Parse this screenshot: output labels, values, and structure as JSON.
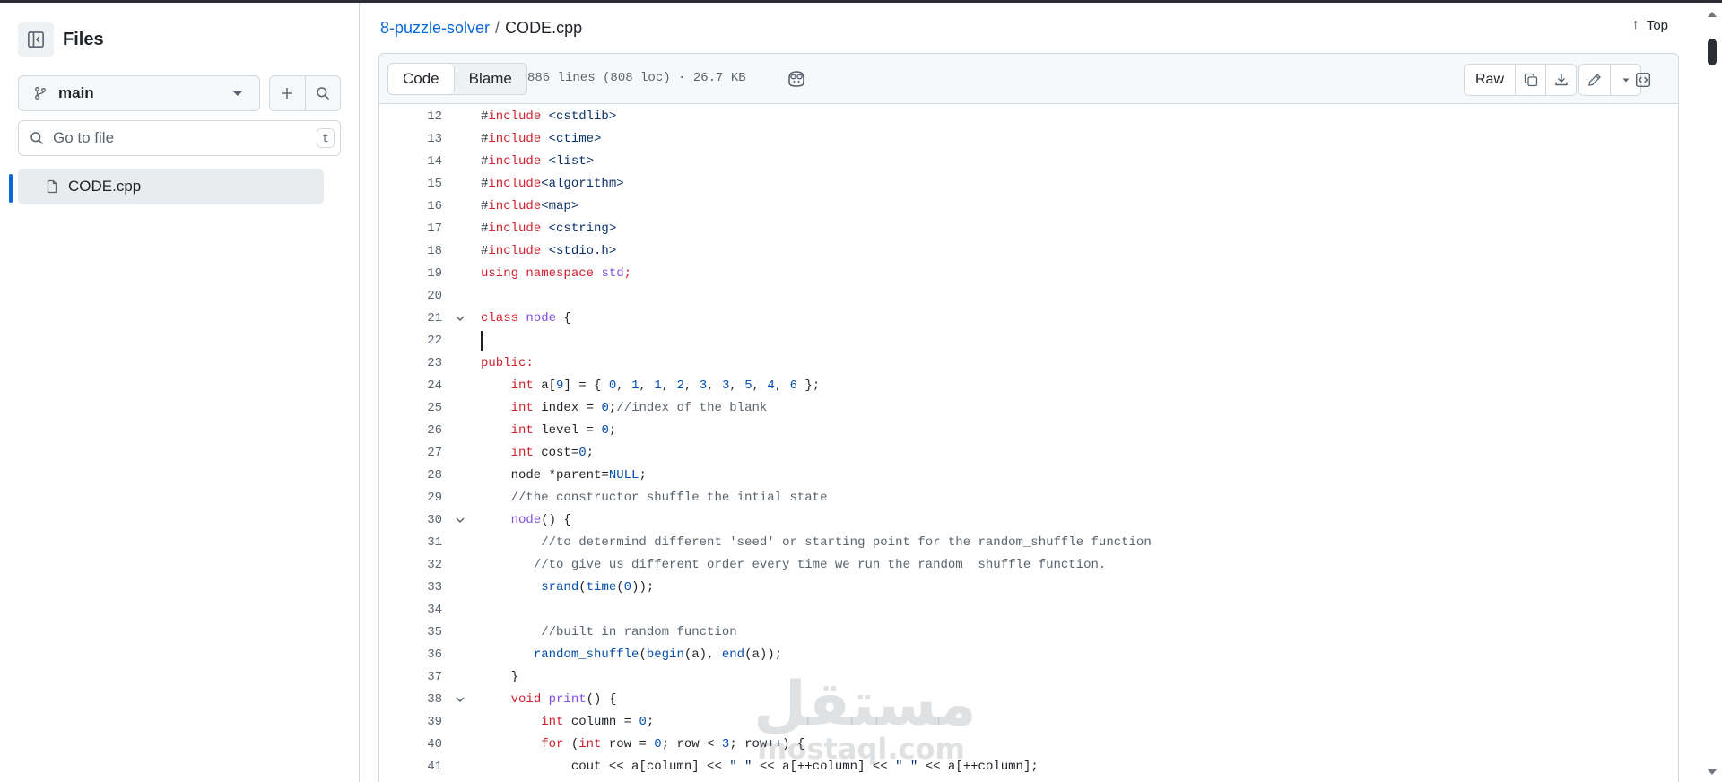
{
  "sidebar": {
    "title": "Files",
    "branch": "main",
    "goto_placeholder": "Go to file",
    "goto_shortcut": "t",
    "files": [
      "CODE.cpp"
    ]
  },
  "breadcrumb": {
    "repo": "8-puzzle-solver",
    "separator": "/",
    "file": "CODE.cpp"
  },
  "top_button": "Top",
  "file_header": {
    "tabs": [
      "Code",
      "Blame"
    ],
    "active_tab": "Code",
    "meta": "886 lines (808 loc) · 26.7 KB",
    "raw_label": "Raw"
  },
  "code_lines": [
    {
      "n": "12",
      "fold": false,
      "tokens": [
        {
          "t": "#"
        },
        {
          "t": "include",
          "c": "k"
        },
        {
          "t": " <cstdlib>",
          "c": "s2"
        }
      ]
    },
    {
      "n": "13",
      "fold": false,
      "tokens": [
        {
          "t": "#"
        },
        {
          "t": "include",
          "c": "k"
        },
        {
          "t": " <ctime>",
          "c": "s2"
        }
      ]
    },
    {
      "n": "14",
      "fold": false,
      "tokens": [
        {
          "t": "#"
        },
        {
          "t": "include",
          "c": "k"
        },
        {
          "t": " <list>",
          "c": "s2"
        }
      ]
    },
    {
      "n": "15",
      "fold": false,
      "tokens": [
        {
          "t": "#"
        },
        {
          "t": "include",
          "c": "k"
        },
        {
          "t": "<algorithm>",
          "c": "s2"
        }
      ]
    },
    {
      "n": "16",
      "fold": false,
      "tokens": [
        {
          "t": "#"
        },
        {
          "t": "include",
          "c": "k"
        },
        {
          "t": "<map>",
          "c": "s2"
        }
      ]
    },
    {
      "n": "17",
      "fold": false,
      "tokens": [
        {
          "t": "#"
        },
        {
          "t": "include",
          "c": "k"
        },
        {
          "t": " <cstring>",
          "c": "s2"
        }
      ]
    },
    {
      "n": "18",
      "fold": false,
      "tokens": [
        {
          "t": "#"
        },
        {
          "t": "include",
          "c": "k"
        },
        {
          "t": " <stdio.h>",
          "c": "s2"
        }
      ]
    },
    {
      "n": "19",
      "fold": false,
      "tokens": [
        {
          "t": "using namespace",
          "c": "k"
        },
        {
          "t": " "
        },
        {
          "t": "std",
          "c": "f"
        },
        {
          "t": ";",
          "c": "k"
        }
      ]
    },
    {
      "n": "20",
      "fold": false,
      "tokens": []
    },
    {
      "n": "21",
      "fold": true,
      "tokens": [
        {
          "t": "class",
          "c": "k"
        },
        {
          "t": " "
        },
        {
          "t": "node",
          "c": "f"
        },
        {
          "t": " {"
        }
      ]
    },
    {
      "n": "22",
      "fold": false,
      "cursor": true,
      "tokens": []
    },
    {
      "n": "23",
      "fold": false,
      "tokens": [
        {
          "t": "public:",
          "c": "k"
        }
      ]
    },
    {
      "n": "24",
      "fold": false,
      "tokens": [
        {
          "t": "    "
        },
        {
          "t": "int",
          "c": "k"
        },
        {
          "t": " a["
        },
        {
          "t": "9",
          "c": "e"
        },
        {
          "t": "] = { "
        },
        {
          "t": "0",
          "c": "e"
        },
        {
          "t": ", "
        },
        {
          "t": "1",
          "c": "e"
        },
        {
          "t": ", "
        },
        {
          "t": "1",
          "c": "e"
        },
        {
          "t": ", "
        },
        {
          "t": "2",
          "c": "e"
        },
        {
          "t": ", "
        },
        {
          "t": "3",
          "c": "e"
        },
        {
          "t": ", "
        },
        {
          "t": "3",
          "c": "e"
        },
        {
          "t": ", "
        },
        {
          "t": "5",
          "c": "e"
        },
        {
          "t": ", "
        },
        {
          "t": "4",
          "c": "e"
        },
        {
          "t": ", "
        },
        {
          "t": "6",
          "c": "e"
        },
        {
          "t": " };"
        }
      ]
    },
    {
      "n": "25",
      "fold": false,
      "tokens": [
        {
          "t": "    "
        },
        {
          "t": "int",
          "c": "k"
        },
        {
          "t": " index = "
        },
        {
          "t": "0",
          "c": "e"
        },
        {
          "t": ";"
        },
        {
          "t": "//index of the blank",
          "c": "c"
        }
      ]
    },
    {
      "n": "26",
      "fold": false,
      "tokens": [
        {
          "t": "    "
        },
        {
          "t": "int",
          "c": "k"
        },
        {
          "t": " level = "
        },
        {
          "t": "0",
          "c": "e"
        },
        {
          "t": ";"
        }
      ]
    },
    {
      "n": "27",
      "fold": false,
      "tokens": [
        {
          "t": "    "
        },
        {
          "t": "int",
          "c": "k"
        },
        {
          "t": " cost="
        },
        {
          "t": "0",
          "c": "e"
        },
        {
          "t": ";"
        }
      ]
    },
    {
      "n": "28",
      "fold": false,
      "tokens": [
        {
          "t": "    node *parent="
        },
        {
          "t": "NULL",
          "c": "e"
        },
        {
          "t": ";"
        }
      ]
    },
    {
      "n": "29",
      "fold": false,
      "tokens": [
        {
          "t": "    "
        },
        {
          "t": "//the constructor shuffle the intial state",
          "c": "c"
        }
      ]
    },
    {
      "n": "30",
      "fold": true,
      "tokens": [
        {
          "t": "    "
        },
        {
          "t": "node",
          "c": "f"
        },
        {
          "t": "() {"
        }
      ]
    },
    {
      "n": "31",
      "fold": false,
      "tokens": [
        {
          "t": "        "
        },
        {
          "t": "//to determind different 'seed' or starting point for the random_shuffle function",
          "c": "c"
        }
      ]
    },
    {
      "n": "32",
      "fold": false,
      "tokens": [
        {
          "t": "       "
        },
        {
          "t": "//to give us different order every time we run the random  shuffle function.",
          "c": "c"
        }
      ]
    },
    {
      "n": "33",
      "fold": false,
      "tokens": [
        {
          "t": "        "
        },
        {
          "t": "srand",
          "c": "e"
        },
        {
          "t": "("
        },
        {
          "t": "time",
          "c": "e"
        },
        {
          "t": "("
        },
        {
          "t": "0",
          "c": "e"
        },
        {
          "t": "));"
        }
      ]
    },
    {
      "n": "34",
      "fold": false,
      "tokens": []
    },
    {
      "n": "35",
      "fold": false,
      "tokens": [
        {
          "t": "        "
        },
        {
          "t": "//built in random function",
          "c": "c"
        }
      ]
    },
    {
      "n": "36",
      "fold": false,
      "tokens": [
        {
          "t": "       "
        },
        {
          "t": "random_shuffle",
          "c": "e"
        },
        {
          "t": "("
        },
        {
          "t": "begin",
          "c": "e"
        },
        {
          "t": "(a), "
        },
        {
          "t": "end",
          "c": "e"
        },
        {
          "t": "(a));"
        }
      ]
    },
    {
      "n": "37",
      "fold": false,
      "tokens": [
        {
          "t": "    }"
        }
      ]
    },
    {
      "n": "38",
      "fold": true,
      "tokens": [
        {
          "t": "    "
        },
        {
          "t": "void",
          "c": "k"
        },
        {
          "t": " "
        },
        {
          "t": "print",
          "c": "f"
        },
        {
          "t": "() {"
        }
      ]
    },
    {
      "n": "39",
      "fold": false,
      "tokens": [
        {
          "t": "        "
        },
        {
          "t": "int",
          "c": "k"
        },
        {
          "t": " column = "
        },
        {
          "t": "0",
          "c": "e"
        },
        {
          "t": ";"
        }
      ]
    },
    {
      "n": "40",
      "fold": false,
      "tokens": [
        {
          "t": "        "
        },
        {
          "t": "for",
          "c": "k"
        },
        {
          "t": " ("
        },
        {
          "t": "int",
          "c": "k"
        },
        {
          "t": " row = "
        },
        {
          "t": "0",
          "c": "e"
        },
        {
          "t": "; row < "
        },
        {
          "t": "3",
          "c": "e"
        },
        {
          "t": "; row++) {"
        }
      ]
    },
    {
      "n": "41",
      "fold": false,
      "tokens": [
        {
          "t": "            cout << a[column] << "
        },
        {
          "t": "\" \"",
          "c": "s2"
        },
        {
          "t": " << a[++column] << "
        },
        {
          "t": "\" \"",
          "c": "s2"
        },
        {
          "t": " << a[++column];"
        }
      ]
    }
  ],
  "watermark": {
    "arabic": "مستقل",
    "latin": "mostaql.com"
  }
}
